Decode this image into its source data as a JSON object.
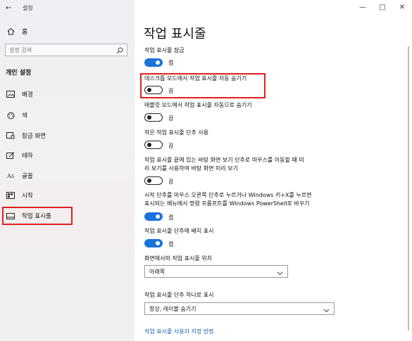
{
  "window": {
    "title": "설정",
    "minimize": "—",
    "maximize": "□",
    "close": "✕"
  },
  "sidebar": {
    "back_icon": "←",
    "home_label": "홈",
    "search_placeholder": "설정 검색",
    "section_title": "개인 설정",
    "items": [
      {
        "label": "배경",
        "icon": "image-icon"
      },
      {
        "label": "색",
        "icon": "palette-icon"
      },
      {
        "label": "잠금 화면",
        "icon": "lock-screen-icon"
      },
      {
        "label": "테마",
        "icon": "theme-icon"
      },
      {
        "label": "글꼴",
        "icon": "font-icon"
      },
      {
        "label": "시작",
        "icon": "start-icon"
      },
      {
        "label": "작업 표시줄",
        "icon": "taskbar-icon"
      }
    ],
    "selected_index": 6
  },
  "main": {
    "title": "작업 표시줄",
    "settings": [
      {
        "label": "작업 표시줄 잠금",
        "state": "켬",
        "on": true
      },
      {
        "label": "데스크톱 모드에서 작업 표시줄 자동 숨기기",
        "state": "끔",
        "on": false
      },
      {
        "label": "태블릿 모드에서 작업 표시줄 자동으로 숨기기",
        "state": "끔",
        "on": false
      },
      {
        "label": "작은 작업 표시줄 단추 사용",
        "state": "끔",
        "on": false
      },
      {
        "label_line1": "작업 표시줄 끝에 있는 바탕 화면 보기 단추로 마우스를 이동할 때 미",
        "label_line2": "리 보기를 사용하여 바탕 화면 미리 보기",
        "state": "끔",
        "on": false
      },
      {
        "label_line1": "시작 단추를 마우스 오른쪽 단추로 누르거나 Windows 키+X를 누르면",
        "label_line2": "표시되는 메뉴에서 명령 프롬프트를 Windows PowerShell로 바꾸기",
        "state": "켬",
        "on": true
      },
      {
        "label": "작업 표시줄 단추에 배지 표시",
        "state": "켬",
        "on": true
      }
    ],
    "location": {
      "label": "화면에서의 작업 표시줄 위치",
      "value": "아래쪽"
    },
    "combine": {
      "label": "작업 표시줄 단추 하나로 표시",
      "value": "항상, 레이블 숨기기"
    },
    "link": "작업 표시줄 사용자 지정 방법"
  },
  "colors": {
    "accent": "#1a73d9",
    "highlight": "#e0201e",
    "link": "#1a5fb4"
  }
}
